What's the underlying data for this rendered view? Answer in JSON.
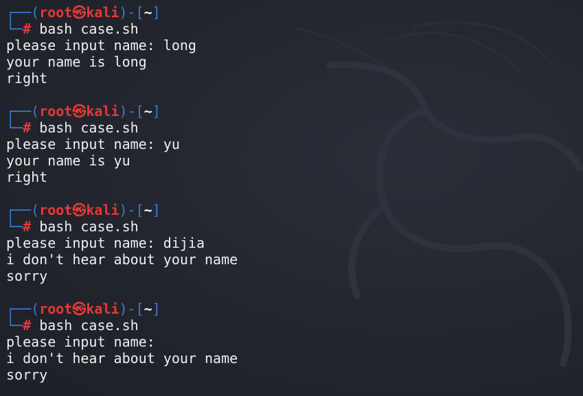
{
  "prompt": {
    "open_paren": "(",
    "user": "root",
    "at_symbol": "㉿",
    "host": "kali",
    "close_paren": ")-[",
    "dir": "~",
    "close_bracket": "]",
    "hash": "#"
  },
  "sessions": [
    {
      "command": "bash case.sh",
      "input_line": "please input name: long",
      "output1": "your name is long",
      "output2": "right"
    },
    {
      "command": "bash case.sh",
      "input_line": "please input name: yu",
      "output1": "your name is yu",
      "output2": "right"
    },
    {
      "command": "bash case.sh",
      "input_line": "please input name: dijia",
      "output1": "i don't hear about your name",
      "output2": "sorry"
    },
    {
      "command": "bash case.sh",
      "input_line": "please input name:",
      "output1": "i don't hear about your name",
      "output2": "sorry"
    }
  ]
}
